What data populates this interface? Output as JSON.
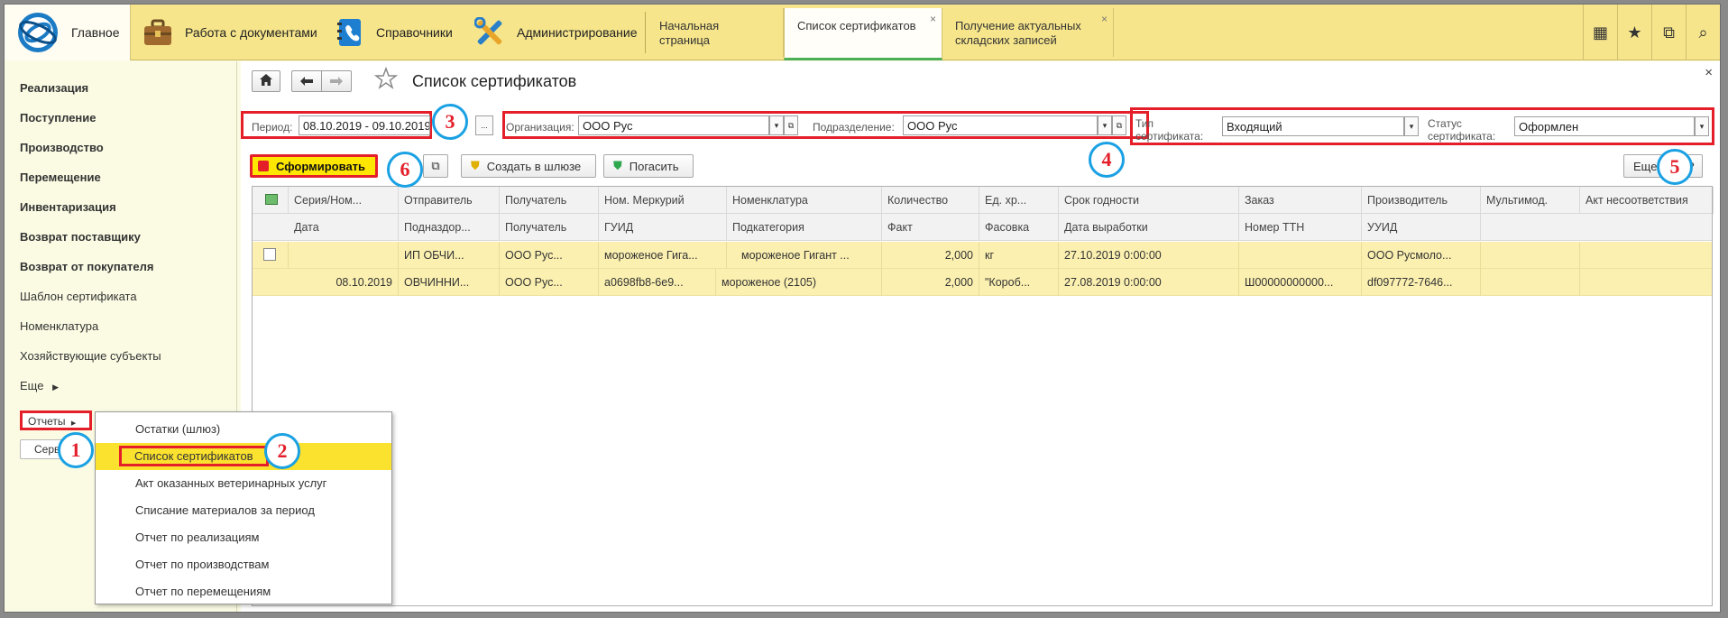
{
  "topbar": {
    "sections": [
      {
        "label": "Главное",
        "icon": "logo-1c"
      },
      {
        "label": "Работа с документами",
        "icon": "briefcase-icon"
      },
      {
        "label": "Справочники",
        "icon": "phonebook-icon"
      },
      {
        "label": "Администрирование",
        "icon": "tools-icon"
      }
    ],
    "tabs": [
      {
        "label": "Начальная страница"
      },
      {
        "label": "Список сертификатов",
        "close": "×"
      },
      {
        "label": "Получение актуальных складских записей",
        "close": "×"
      }
    ],
    "icons": {
      "apps": "▦",
      "favorites": "★",
      "history": "⧉",
      "search": "⌕"
    }
  },
  "sidebar": {
    "items": [
      {
        "label": "Реализация"
      },
      {
        "label": "Поступление"
      },
      {
        "label": "Производство"
      },
      {
        "label": "Перемещение"
      },
      {
        "label": "Инвентаризация"
      },
      {
        "label": "Возврат поставщику"
      },
      {
        "label": "Возврат от покупателя"
      },
      {
        "label": "Шаблон сертификата"
      },
      {
        "label": "Номенклатура"
      },
      {
        "label": "Хозяйствующие субъекты"
      },
      {
        "label": "Еще"
      }
    ],
    "reports_label": "Отчеты",
    "services_label": "Серв"
  },
  "form": {
    "title": "Список сертификатов",
    "close": "×",
    "period_label": "Период:",
    "period_value": "08.10.2019 - 09.10.2019",
    "period_btn": "...",
    "org_label": "Организация:",
    "org_value": "ООО Рус",
    "div_label": "Подразделение:",
    "div_value": "ООО Рус",
    "type_label": "Тип сертификата:",
    "type_value": "Входящий",
    "status_label": "Статус сертификата:",
    "status_value": "Оформлен",
    "buttons": {
      "form": "Сформировать",
      "gateway": "Создать в шлюзе",
      "redeem": "Погасить",
      "more": "Еще",
      "help": "?"
    }
  },
  "table": {
    "header1": [
      "Серия/Ном...",
      "Отправитель",
      "Получатель",
      "Ном. Меркурий",
      "Номенклатура",
      "Количество",
      "Ед. хр...",
      "Срок годности",
      "Заказ",
      "Производитель",
      "Мультимод.",
      "Акт несоответствия"
    ],
    "header2": [
      "Дата",
      "Подназдор...",
      "Получатель",
      "ГУИД",
      "Подкатегория",
      "Факт",
      "Фасовка",
      "Дата выработки",
      "Номер ТТН",
      "УУИД"
    ],
    "row1": [
      "",
      "ИП ОБЧИ...",
      "ООО Рус...",
      "мороженое Гига...",
      "мороженое Гигант ...",
      "2,000",
      "кг",
      "27.10.2019 0:00:00",
      "",
      "ООО Русмоло..."
    ],
    "row2": [
      "08.10.2019",
      "ОВЧИННИ...",
      "ООО Рус...",
      "a0698fb8-6e9...",
      "мороженое (2105)",
      "2,000",
      "\"Короб...",
      "27.08.2019 0:00:00",
      "Ш00000000000...",
      "df097772-7646..."
    ]
  },
  "menu": {
    "items": [
      "Остатки (шлюз)",
      "Список сертификатов",
      "Акт оказанных ветеринарных услуг",
      "Списание материалов за период",
      "Отчет по реализациям",
      "Отчет по производствам",
      "Отчет по перемещениям"
    ]
  },
  "markers": [
    "1",
    "2",
    "3",
    "4",
    "5",
    "6"
  ],
  "colors": {
    "accent_yellow": "#f6e58b",
    "highlight": "#fbe22e",
    "annotation_red": "#e41f2a",
    "annotation_blue": "#1aa1e3"
  }
}
